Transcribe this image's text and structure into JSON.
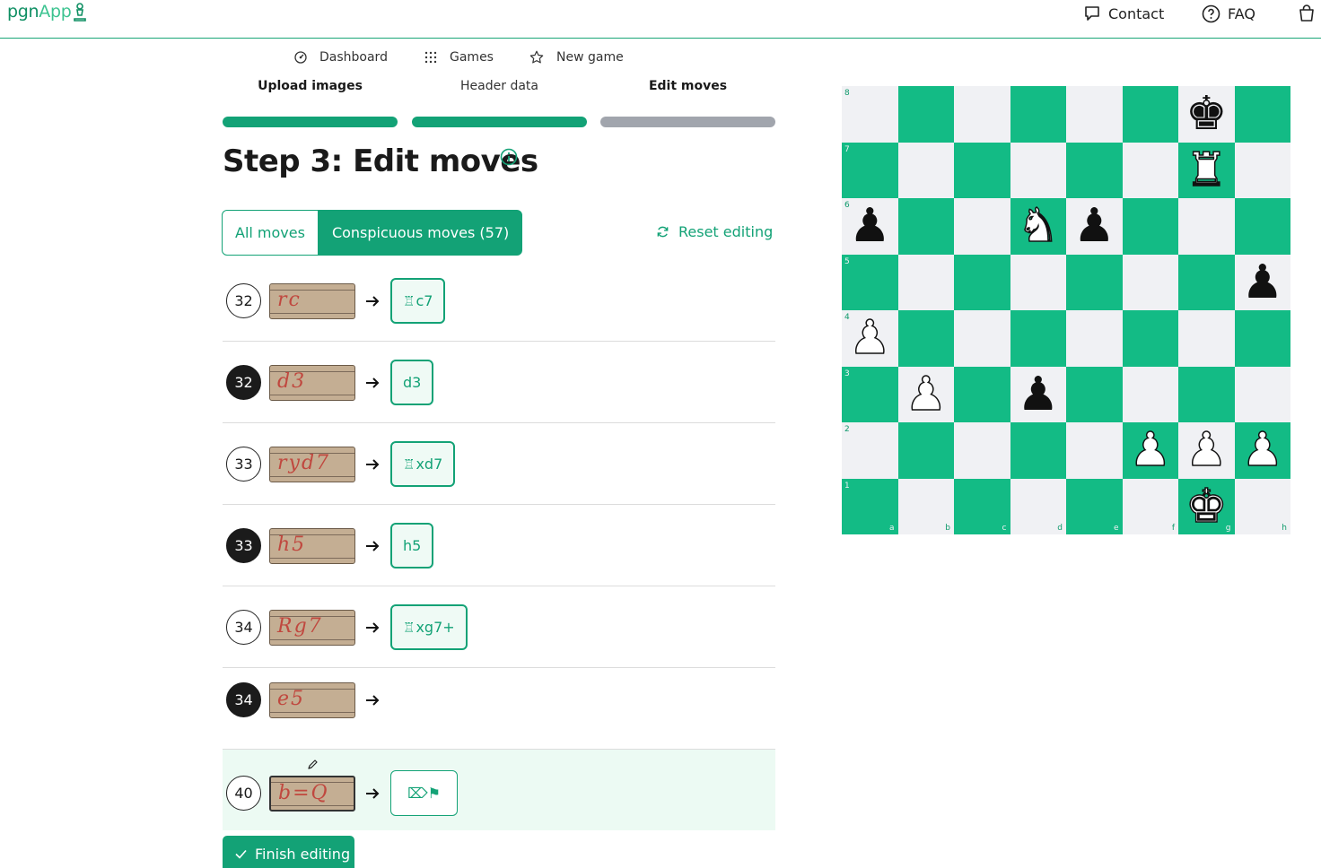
{
  "brand": {
    "part1": "pgn",
    "part2": "App"
  },
  "topnav": {
    "contact": "Contact",
    "faq": "FAQ"
  },
  "subnav": {
    "dashboard": "Dashboard",
    "games": "Games",
    "new_game": "New game"
  },
  "steps": [
    {
      "label": "Upload images",
      "state": "done"
    },
    {
      "label": "Header data",
      "state": "done"
    },
    {
      "label": "Edit moves",
      "state": "current"
    }
  ],
  "page_title": "Step 3: Edit moves",
  "filter": {
    "all": "All moves",
    "conspicuous": "Conspicuous moves (57)",
    "selected": "conspicuous"
  },
  "reset_label": "Reset editing",
  "moves": [
    {
      "number": "32",
      "color": "white",
      "scan_text": "rc",
      "piece": "♖",
      "move": "c7"
    },
    {
      "number": "32",
      "color": "black",
      "scan_text": "d3",
      "piece": "",
      "move": "d3"
    },
    {
      "number": "33",
      "color": "white",
      "scan_text": "ryd7",
      "piece": "♖",
      "move": "xd7"
    },
    {
      "number": "33",
      "color": "black",
      "scan_text": "h5",
      "piece": "",
      "move": "h5"
    },
    {
      "number": "34",
      "color": "white",
      "scan_text": "Rg7",
      "piece": "♖",
      "move": "xg7+"
    },
    {
      "number": "34",
      "color": "black",
      "scan_text": "e5",
      "piece": "",
      "move": ""
    },
    {
      "number": "40",
      "color": "white",
      "scan_text": "b=Q",
      "piece": "",
      "move": "⌦⚑",
      "active": true
    }
  ],
  "finish_label": "Finish editing",
  "board": {
    "files": [
      "a",
      "b",
      "c",
      "d",
      "e",
      "f",
      "g",
      "h"
    ],
    "ranks": [
      "8",
      "7",
      "6",
      "5",
      "4",
      "3",
      "2",
      "1"
    ],
    "pieces": {
      "g8": "♚",
      "g7": "♖",
      "a6": "♟",
      "d6": "♘",
      "e6": "♟",
      "h5": "♟",
      "a4": "♙",
      "b3": "♙",
      "d3": "♟",
      "f2": "♙",
      "g2": "♙",
      "h2": "♙",
      "g1": "♔"
    },
    "light_color": "#f0f1f4",
    "dark_color": "#13bb85"
  },
  "accent_color": "#13a276"
}
